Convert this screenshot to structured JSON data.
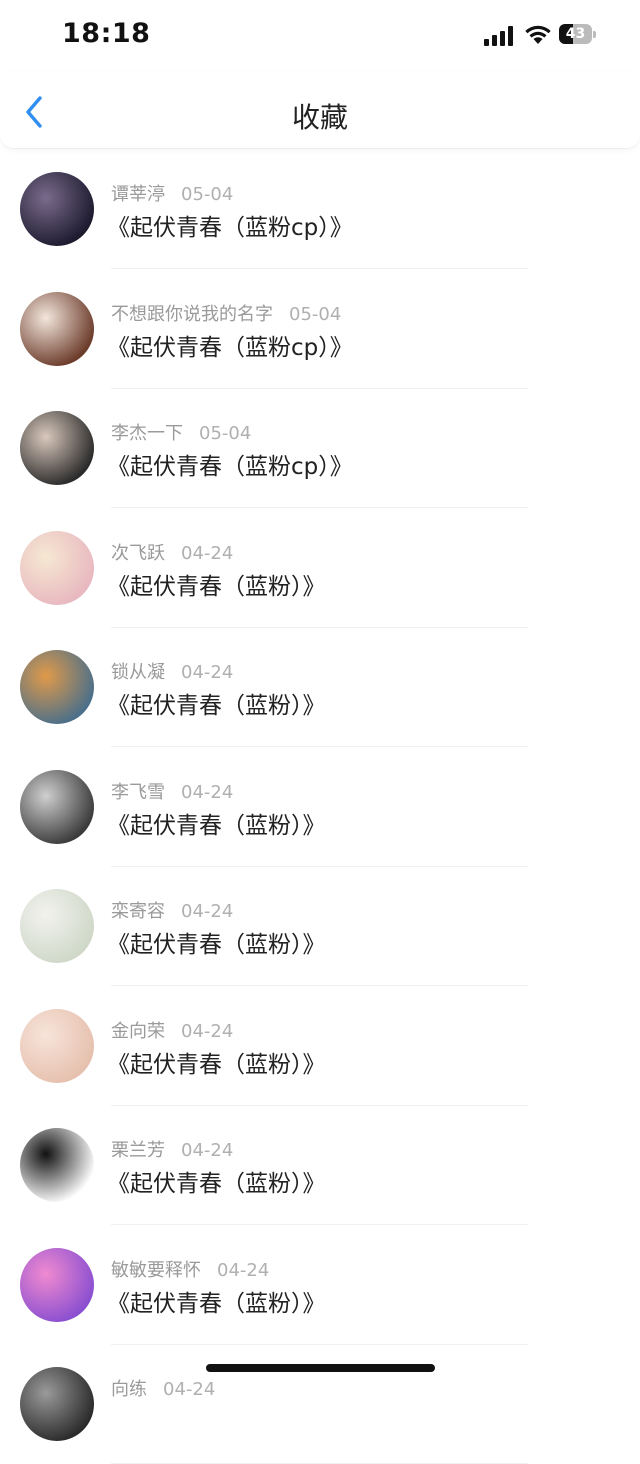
{
  "status": {
    "time": "18:18",
    "battery": "43",
    "battery_level": 0.43
  },
  "nav": {
    "title": "收藏"
  },
  "items": [
    {
      "name": "谭莘渟",
      "date": "05-04",
      "title": "《起伏青春（蓝粉cp）》",
      "avatar": "avatar-dark-hair-girl",
      "c1": "#1c1a2e",
      "c2": "#7a6b8c"
    },
    {
      "name": "不想跟你说我的名字",
      "date": "05-04",
      "title": "《起伏青春（蓝粉cp）》",
      "avatar": "avatar-bear-cartoon",
      "c1": "#6b3b2a",
      "c2": "#f3e6dd"
    },
    {
      "name": "李杰一下",
      "date": "05-04",
      "title": "《起伏青春（蓝粉cp）》",
      "avatar": "avatar-boy-photo",
      "c1": "#2a2a2a",
      "c2": "#d9c8bc"
    },
    {
      "name": "次飞跃",
      "date": "04-24",
      "title": "《起伏青春（蓝粉）》",
      "avatar": "avatar-anime-girl",
      "c1": "#e8b8c0",
      "c2": "#f6e8d2"
    },
    {
      "name": "锁从凝",
      "date": "04-24",
      "title": "《起伏青春（蓝粉）》",
      "avatar": "avatar-toast",
      "c1": "#4a6f8a",
      "c2": "#e09a4a"
    },
    {
      "name": "李飞雪",
      "date": "04-24",
      "title": "《起伏青春（蓝粉）》",
      "avatar": "avatar-bw-photo",
      "c1": "#3a3a3a",
      "c2": "#cfcfcf"
    },
    {
      "name": "栾寄容",
      "date": "04-24",
      "title": "《起伏青春（蓝粉）》",
      "avatar": "avatar-faded-photo",
      "c1": "#cfd8c8",
      "c2": "#f2f2ee"
    },
    {
      "name": "金向荣",
      "date": "04-24",
      "title": "《起伏青春（蓝粉）》",
      "avatar": "avatar-girl-face",
      "c1": "#e6c0ae",
      "c2": "#f7e4da"
    },
    {
      "name": "栗兰芳",
      "date": "04-24",
      "title": "《起伏青春（蓝粉）》",
      "avatar": "avatar-sketch-kids",
      "c1": "#ffffff",
      "c2": "#111111"
    },
    {
      "name": "敏敏要释怀",
      "date": "04-24",
      "title": "《起伏青春（蓝粉）》",
      "avatar": "avatar-purple-cartoon",
      "c1": "#8a4fd0",
      "c2": "#f08ad0"
    },
    {
      "name": "向练",
      "date": "04-24",
      "title": "",
      "avatar": "avatar-dark-photo",
      "c1": "#2a2a2a",
      "c2": "#9a9a9a"
    }
  ]
}
